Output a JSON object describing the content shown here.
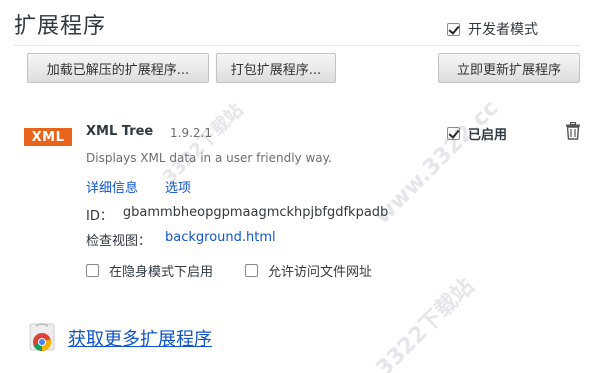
{
  "header": {
    "title": "扩展程序",
    "developer_mode": {
      "label": "开发者模式",
      "checked": true
    }
  },
  "toolbar": {
    "load_unpacked_label": "加载已解压的扩展程序...",
    "pack_label": "打包扩展程序...",
    "update_label": "立即更新扩展程序"
  },
  "extension": {
    "logo_text": "XML",
    "logo_color": "#e8641b",
    "name": "XML Tree",
    "version": "1.9.2.1",
    "description": "Displays XML data in a user friendly way.",
    "details_link": "详细信息",
    "options_link": "选项",
    "id_label": "ID：",
    "id_value": "gbammbheopgpmaagmckhpjbfgdfkpadb",
    "views_label": "检查视图：",
    "views_link": "background.html",
    "incognito_label": "在隐身模式下启用",
    "incognito_checked": false,
    "file_url_label": "允许访问文件网址",
    "file_url_checked": false,
    "enabled_label": "已启用",
    "enabled_checked": true,
    "remove_icon": "trash-icon"
  },
  "footer": {
    "get_more_label": "获取更多扩展程序",
    "get_more_icon": "chrome-webstore-icon"
  },
  "watermark": {
    "text_1": "www.3322.cc",
    "text_2": "3322下载站",
    "text_3": "3322下载站"
  },
  "colors": {
    "link": "#1155cc",
    "text": "#303942",
    "muted": "#6d6d6d"
  }
}
